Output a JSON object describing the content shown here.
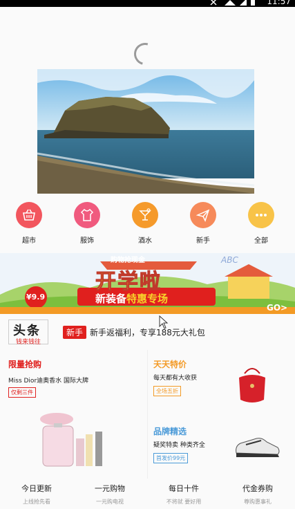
{
  "status_bar": {
    "time": "11:57"
  },
  "categories": [
    {
      "label": "超市",
      "color": "#f2565e",
      "icon": "basket-icon"
    },
    {
      "label": "服饰",
      "color": "#f05a7e",
      "icon": "shirt-icon"
    },
    {
      "label": "酒水",
      "color": "#f59a2b",
      "icon": "cocktail-icon"
    },
    {
      "label": "新手",
      "color": "#f68a5a",
      "icon": "paper-plane-icon"
    },
    {
      "label": "全部",
      "color": "#f8c348",
      "icon": "more-dots-icon"
    }
  ],
  "promo_banner": {
    "top_ribbon": "购物抢现金",
    "headline": "开学啦",
    "subline_white": "新装备",
    "subline_yellow": "特惠专场",
    "price": "¥9.9",
    "go": "GO>",
    "abc": "ABC"
  },
  "headline": {
    "logo_big": "头条",
    "logo_small": "钱来钱往",
    "tag": "新手",
    "text": "新手返福利，专享188元大礼包"
  },
  "deals": {
    "flash": {
      "title": "限量抢购",
      "sub": "Miss Dior迪奥香水 国际大牌",
      "tag": "仅剩三件"
    },
    "special": {
      "title": "天天特价",
      "sub": "每天都有大收获",
      "tag": "全场五折"
    },
    "brand": {
      "title": "品牌精选",
      "sub": "疑奖特卖 种类齐全",
      "tag": "首发价99元"
    }
  },
  "bottom_nav": [
    {
      "title": "今日更新",
      "sub": "上线抢先看"
    },
    {
      "title": "一元购物",
      "sub": "一元购电视"
    },
    {
      "title": "每日十件",
      "sub": "不将就 要好用"
    },
    {
      "title": "代金券购",
      "sub": "尊购惠事礼"
    }
  ],
  "colors": {
    "red": "#e0201e",
    "orange": "#f39a25",
    "blue": "#4a9ad8"
  }
}
